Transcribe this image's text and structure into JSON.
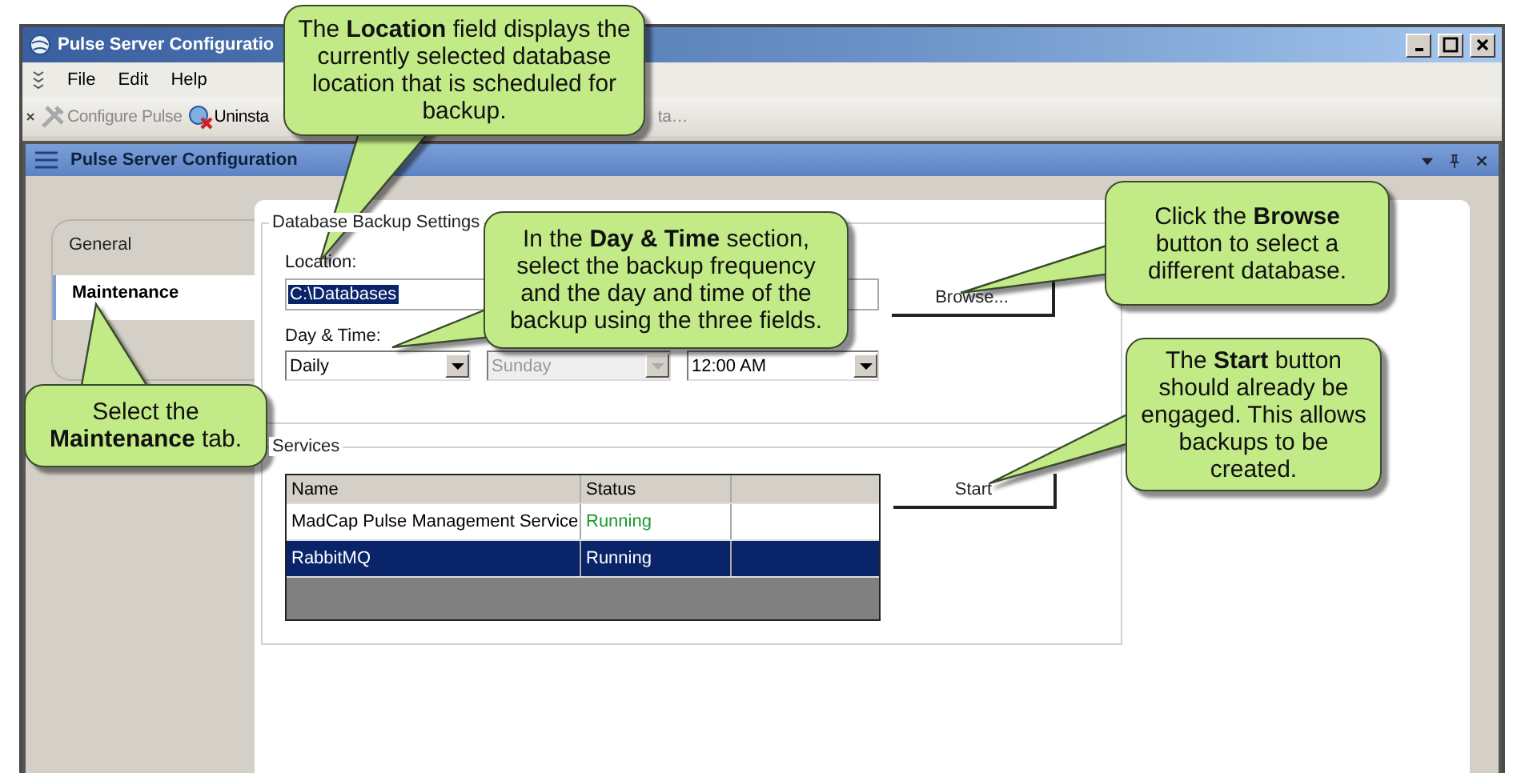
{
  "window": {
    "title": "Pulse Server Configuratio"
  },
  "menu": [
    "File",
    "Edit",
    "Help"
  ],
  "toolbar": [
    {
      "label": "Configure Pulse",
      "disabled": true,
      "kind": "configure"
    },
    {
      "label": "Uninsta",
      "disabled": false,
      "kind": "uninstall"
    },
    {
      "label": "ta…",
      "disabled": true,
      "kind": "none"
    }
  ],
  "panel": {
    "title": "Pulse Server Configuration"
  },
  "tabs": [
    {
      "label": "General",
      "selected": false
    },
    {
      "label": "Maintenance",
      "selected": true
    }
  ],
  "backup": {
    "title": "Database Backup Settings",
    "location_label": "Location:",
    "location_value": "C:\\Databases",
    "browse": "Browse...",
    "day_time_label": "Day & Time:",
    "selects": [
      {
        "value": "Daily",
        "disabled": false
      },
      {
        "value": "Sunday",
        "disabled": true
      },
      {
        "value": "12:00 AM",
        "disabled": false
      }
    ]
  },
  "services": {
    "title": "Services",
    "columns": [
      "Name",
      "Status"
    ],
    "rows": [
      {
        "name": "MadCap Pulse Management Service",
        "status": "Running",
        "selected": false
      },
      {
        "name": "RabbitMQ",
        "status": "Running",
        "selected": true
      }
    ],
    "start": "Start"
  },
  "callouts": [
    {
      "text": "The **Location** field displays the currently selected database location that is scheduled for backup."
    },
    {
      "text": "In the **Day & Time** section, select the backup frequency and the day and time of the backup using the three fields."
    },
    {
      "text": "Click the **Browse** button to select a different database."
    },
    {
      "text": "Select the **Maintenance** tab."
    },
    {
      "text": "The **Start** button should already be engaged. This allows backups to be created."
    }
  ]
}
